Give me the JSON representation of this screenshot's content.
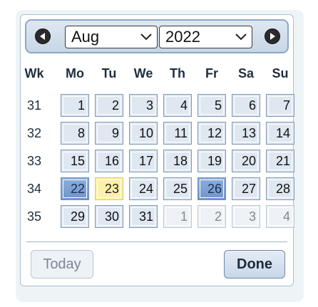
{
  "header": {
    "prev_icon": "triangle-left-icon",
    "next_icon": "triangle-right-icon",
    "month": "Aug",
    "year": "2022"
  },
  "weekdays": [
    "Wk",
    "Mo",
    "Tu",
    "We",
    "Th",
    "Fr",
    "Sa",
    "Su"
  ],
  "weeks": [
    {
      "wk": "31",
      "days": [
        {
          "d": "1",
          "state": "current"
        },
        {
          "d": "2",
          "state": "current"
        },
        {
          "d": "3",
          "state": "current"
        },
        {
          "d": "4",
          "state": "current"
        },
        {
          "d": "5",
          "state": "current"
        },
        {
          "d": "6",
          "state": "current"
        },
        {
          "d": "7",
          "state": "current"
        }
      ]
    },
    {
      "wk": "32",
      "days": [
        {
          "d": "8",
          "state": "current"
        },
        {
          "d": "9",
          "state": "current"
        },
        {
          "d": "10",
          "state": "current"
        },
        {
          "d": "11",
          "state": "current"
        },
        {
          "d": "12",
          "state": "current"
        },
        {
          "d": "13",
          "state": "current"
        },
        {
          "d": "14",
          "state": "current"
        }
      ]
    },
    {
      "wk": "33",
      "days": [
        {
          "d": "15",
          "state": "current"
        },
        {
          "d": "16",
          "state": "current"
        },
        {
          "d": "17",
          "state": "current"
        },
        {
          "d": "18",
          "state": "current"
        },
        {
          "d": "19",
          "state": "current"
        },
        {
          "d": "20",
          "state": "current"
        },
        {
          "d": "21",
          "state": "current"
        }
      ]
    },
    {
      "wk": "34",
      "days": [
        {
          "d": "22",
          "state": "selected"
        },
        {
          "d": "23",
          "state": "today"
        },
        {
          "d": "24",
          "state": "current"
        },
        {
          "d": "25",
          "state": "current"
        },
        {
          "d": "26",
          "state": "selected"
        },
        {
          "d": "27",
          "state": "current"
        },
        {
          "d": "28",
          "state": "current"
        }
      ]
    },
    {
      "wk": "35",
      "days": [
        {
          "d": "29",
          "state": "current"
        },
        {
          "d": "30",
          "state": "current"
        },
        {
          "d": "31",
          "state": "current"
        },
        {
          "d": "1",
          "state": "other"
        },
        {
          "d": "2",
          "state": "other"
        },
        {
          "d": "3",
          "state": "other"
        },
        {
          "d": "4",
          "state": "other"
        }
      ]
    }
  ],
  "footer": {
    "today_label": "Today",
    "done_label": "Done"
  },
  "colors": {
    "selected": "#7f9fd0",
    "today": "#fbf1a7",
    "cell": "#dfe8f1",
    "header": "#d3dfec"
  }
}
